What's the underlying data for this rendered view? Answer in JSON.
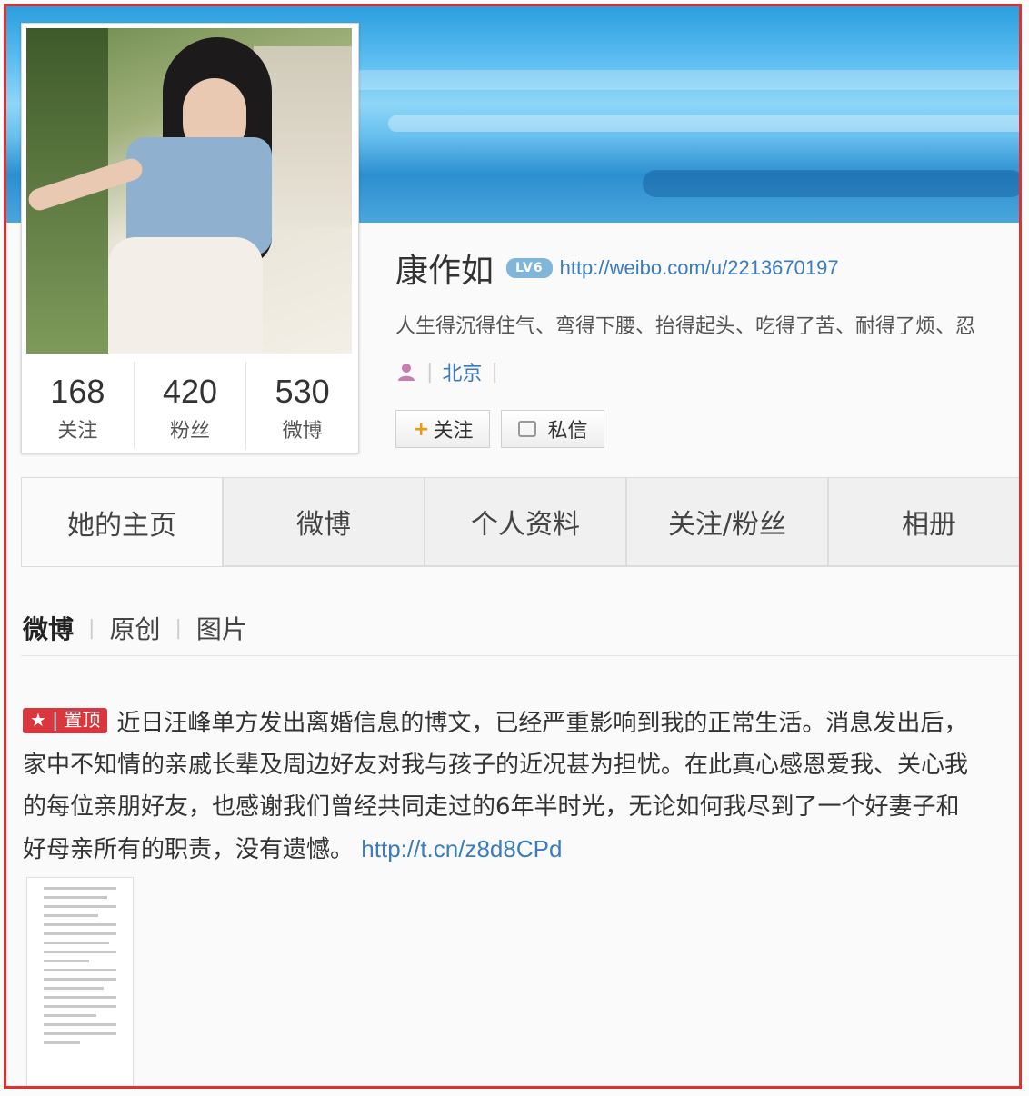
{
  "profile": {
    "name": "康作如",
    "level_badge": "LV6",
    "home_url": "http://weibo.com/u/2213670197",
    "bio": "人生得沉得住气、弯得下腰、抬得起头、吃得了苦、耐得了烦、忍",
    "location": "北京"
  },
  "stats": [
    {
      "count": "168",
      "label": "关注"
    },
    {
      "count": "420",
      "label": "粉丝"
    },
    {
      "count": "530",
      "label": "微博"
    }
  ],
  "buttons": {
    "follow": "关注",
    "message": "私信"
  },
  "tabs": [
    "她的主页",
    "微博",
    "个人资料",
    "关注/粉丝",
    "相册"
  ],
  "subtabs": [
    "微博",
    "原创",
    "图片"
  ],
  "post": {
    "pin_label": "置顶",
    "lines": [
      "近日汪峰单方发出离婚信息的博文，已经严重影响到我的正常生活。消息发出后，",
      "家中不知情的亲戚长辈及周边好友对我与孩子的近况甚为担忧。在此真心感恩爱我、关心我",
      "的每位亲朋好友，也感谢我们曾经共同走过的6年半时光，无论如何我尽到了一个好妻子和",
      "好母亲所有的职责，没有遗憾。"
    ],
    "link": "http://t.cn/z8d8CPd"
  },
  "colors": {
    "frame": "#e2302f",
    "link": "#3a7cbf",
    "pin": "#d9363e"
  }
}
